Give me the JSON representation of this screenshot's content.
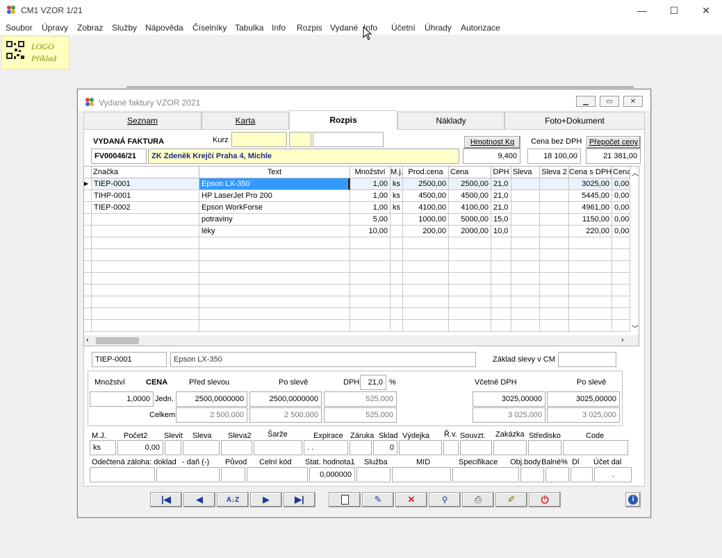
{
  "app": {
    "title": "CM1 VZOR 1/21"
  },
  "menu": [
    "Soubor",
    "Úpravy",
    "Zobraz",
    "Služby",
    "Nápověda",
    "Číselníky",
    "Tabulka",
    "Info",
    "Rozpis",
    "Vydané",
    "Info",
    "Účetní",
    "Úhrady",
    "Autorizace"
  ],
  "logo": {
    "line1": "LOGO",
    "line2": "Příklad"
  },
  "window": {
    "title": "Vydané faktury VZOR  2021"
  },
  "tabs": [
    "Seznam",
    "Karta",
    "Rozpis",
    "Náklady",
    "Foto+Dokument"
  ],
  "header": {
    "doc_type": "VYDANÁ FAKTURA",
    "kurz_label": "Kurz",
    "doc_no": "FV00046/21",
    "customer": "ZK Zdeněk Krejčí  Praha 4, Michle",
    "weight_btn": "Hmotnost Kg",
    "weight": "9,400",
    "price_label": "Cena bez DPH",
    "price": "18 100,00",
    "recalc_btn": "Přepočet ceny",
    "total": "21 381,00"
  },
  "grid": {
    "columns": [
      "Značka",
      "Text",
      "Množství",
      "M.j.",
      "Prod.cena",
      "Cena",
      "DPH",
      "Sleva",
      "Sleva 2",
      "Cena s DPH",
      "Cena"
    ],
    "rows": [
      [
        "TIEP-0001",
        "Epson LX-350",
        "1,00",
        "ks",
        "2500,00",
        "2500,00",
        "21,0",
        "",
        "",
        "3025,00",
        "0,00"
      ],
      [
        "TIHP-0001",
        "HP LaserJet Pro 200",
        "1,00",
        "ks",
        "4500,00",
        "4500,00",
        "21,0",
        "",
        "",
        "5445,00",
        "0,00"
      ],
      [
        "TIEP-0002",
        "Epson WorkForse",
        "1,00",
        "ks",
        "4100,00",
        "4100,00",
        "21,0",
        "",
        "",
        "4961,00",
        "0,00"
      ],
      [
        "",
        "potraviny",
        "5,00",
        "",
        "1000,00",
        "5000,00",
        "15,0",
        "",
        "",
        "1150,00",
        "0,00"
      ],
      [
        "",
        "léky",
        "10,00",
        "",
        "200,00",
        "2000,00",
        "10,0",
        "",
        "",
        "220,00",
        "0,00"
      ]
    ]
  },
  "detail": {
    "code": "TIEP-0001",
    "name": "Epson LX-350",
    "zaklad_label": "Základ slevy v CM",
    "mnozstvi_label": "Množství",
    "cena_label": "CENA",
    "pred_label": "Před slevou",
    "po_label": "Po slevě",
    "dph_label": "DPH",
    "dph_value": "21,0",
    "pct": "%",
    "vcetne_label": "Včetně DPH",
    "po2_label": "Po slevě",
    "qty": "1,0000",
    "jedn_label": "Jedn.",
    "jedn_pred": "2500,0000000",
    "jedn_po": "2500,0000000",
    "jedn_dph": "525,000",
    "jedn_vc": "3025,00000",
    "jedn_vc_po": "3025,00000",
    "celkem_label": "Celkem",
    "celk_pred": "2 500,000",
    "celk_po": "2 500,000",
    "celk_dph": "525,000",
    "celk_vc": "3 025,000",
    "celk_vc_po": "3 025,000"
  },
  "fields1": {
    "labels": [
      "M.J.",
      "Počet2",
      "Slevit",
      "Sleva",
      "Sleva2",
      "Šarže",
      "Expirace",
      "Záruka",
      "Sklad",
      "Výdejka",
      "Ř.v.",
      "Souvzt.",
      "Zakázka",
      "Středisko",
      "Code"
    ],
    "mj": "ks",
    "pocet2": "0,00",
    "expirace": ". .",
    "sklad": "0"
  },
  "fields2": {
    "labels": [
      "Odečtená záloha: doklad",
      "- daň (-)",
      "Původ",
      "Celní kód",
      "Stat. hodnota1",
      "Služba",
      "MID",
      "Specifikace",
      "Obj.body",
      "Balné%",
      "Dl",
      "Účet dal"
    ],
    "stat": "0,000000",
    "ucet": "."
  },
  "colors": {
    "selection": "#3399ff",
    "highlight": "#ffffc8",
    "power": "#e02020"
  }
}
